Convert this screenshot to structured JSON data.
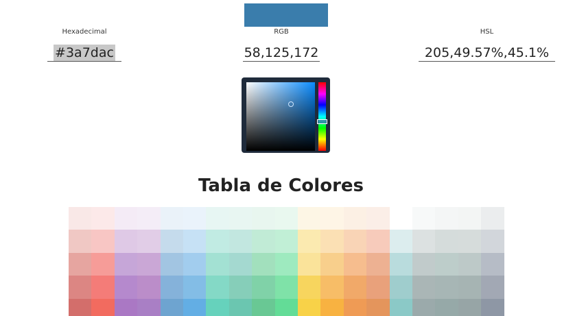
{
  "preview": {
    "color": "#3a7dac"
  },
  "fields": {
    "hex": {
      "label": "Hexadecimal",
      "value": "#3a7dac"
    },
    "rgb": {
      "label": "RGB",
      "value": "58,125,172"
    },
    "hsl": {
      "label": "HSL",
      "value": "205,49.57%,45.1%"
    }
  },
  "picker": {
    "hue": 205,
    "saturation_fraction": 0.65,
    "value_fraction": 0.68
  },
  "table": {
    "title": "Tabla de Colores",
    "rows": [
      [
        "#f9e8e7",
        "#fce9e9",
        "#f4ebf6",
        "#f4edf7",
        "#eaf2f9",
        "#eaf3fb",
        "#e7f6f3",
        "#e8f6f2",
        "#e8f6ef",
        "#e9f8ef",
        "#fdf6e5",
        "#fef5e6",
        "#fcf0e4",
        "#fbeee7",
        "#ffffff",
        "#f7f9f9",
        "#f4f6f6",
        "#f3f5f4",
        "#ebedee"
      ],
      [
        "#f0c8c4",
        "#f8c6c4",
        "#dfc9e6",
        "#e1cde7",
        "#c5dbec",
        "#c6e1f5",
        "#c1ebe3",
        "#c2e7e0",
        "#c1ebd6",
        "#c1efd6",
        "#fbeab0",
        "#fbe0b4",
        "#f9d4b6",
        "#f7cbbb",
        "#dcedee",
        "#dce1e1",
        "#d5dcdb",
        "#d6dcdb",
        "#d2d6db"
      ],
      [
        "#e6a5a0",
        "#f69c98",
        "#c6a6d8",
        "#caa7d6",
        "#a2c5e2",
        "#a2cdee",
        "#a3e1d3",
        "#a4d9d0",
        "#a2e0bd",
        "#9eeabf",
        "#fae39a",
        "#f8cf8c",
        "#f6bd8e",
        "#edb192",
        "#b9dcdd",
        "#c1cbcb",
        "#bdcdca",
        "#bdc9c8",
        "#b6bcc6"
      ],
      [
        "#dc8683",
        "#f47c78",
        "#b589cd",
        "#bb8dc9",
        "#85b2da",
        "#83bde6",
        "#84d9c6",
        "#86ceb9",
        "#80d2a8",
        "#7fe2a8",
        "#f7d55e",
        "#f7bd67",
        "#f1a969",
        "#e9a17b",
        "#9fcdcd",
        "#aab6b6",
        "#a7b6b5",
        "#a6b4b3",
        "#a2a8b4"
      ],
      [
        "#d36e6b",
        "#f26b5f",
        "#aa78c4",
        "#a97fc5",
        "#6ea4d0",
        "#63aee4",
        "#66d2bc",
        "#6bc6b0",
        "#69c894",
        "#63dc97",
        "#f8d248",
        "#f8b241",
        "#ef9b55",
        "#e4955c",
        "#8bc9c7",
        "#9baaab",
        "#96a9a8",
        "#97a5a6",
        "#8e97a5"
      ]
    ]
  }
}
